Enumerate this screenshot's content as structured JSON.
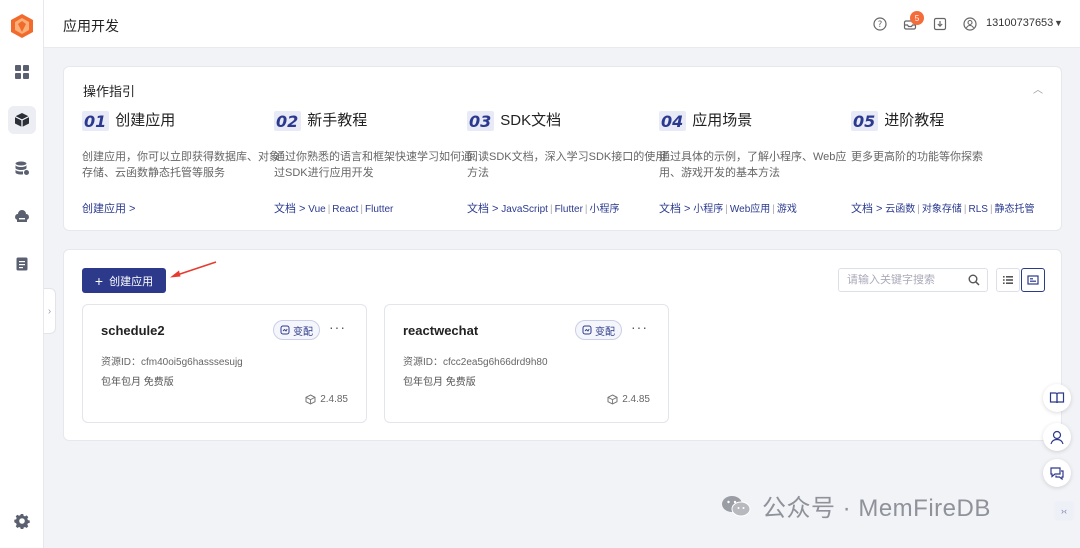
{
  "header": {
    "title": "应用开发",
    "notification_count": "5",
    "username": "13100737653"
  },
  "guide": {
    "title": "操作指引",
    "steps": [
      {
        "num": "01",
        "title": "创建应用",
        "desc": "创建应用，你可以立即获得数据库、对象存储、云函数静态托管等服务",
        "lead": "创建应用 >",
        "links": []
      },
      {
        "num": "02",
        "title": "新手教程",
        "desc": "通过你熟悉的语言和框架快速学习如何通过SDK进行应用开发",
        "lead": "文档 >",
        "links": [
          "Vue",
          "React",
          "Flutter"
        ]
      },
      {
        "num": "03",
        "title": "SDK文档",
        "desc": "阅读SDK文档，深入学习SDK接口的使用方法",
        "lead": "文档 >",
        "links": [
          "JavaScript",
          "Flutter",
          "小程序"
        ]
      },
      {
        "num": "04",
        "title": "应用场景",
        "desc": "通过具体的示例，了解小程序、Web应用、游戏开发的基本方法",
        "lead": "文档 >",
        "links": [
          "小程序",
          "Web应用",
          "游戏"
        ]
      },
      {
        "num": "05",
        "title": "进阶教程",
        "desc": "更多更高阶的功能等你探索",
        "lead": "文档 >",
        "links": [
          "云函数",
          "对象存储",
          "RLS",
          "静态托管"
        ]
      }
    ]
  },
  "apps": {
    "create_label": "创建应用",
    "search_placeholder": "请输入关键字搜索",
    "items": [
      {
        "name": "schedule2",
        "tag": "变配",
        "resource_id": "资源ID：cfm40oi5g6hasssesujg",
        "plan": "包年包月 免费版",
        "version": "2.4.85"
      },
      {
        "name": "reactwechat",
        "tag": "变配",
        "resource_id": "资源ID：cfcc2ea5g6h66drd9h80",
        "plan": "包年包月 免费版",
        "version": "2.4.85"
      }
    ]
  },
  "watermark": {
    "text": "公众号 · MemFireDB"
  },
  "colors": {
    "primary": "#2d3a8c",
    "badge": "#f56c3b",
    "logo": "#f26b2c"
  }
}
